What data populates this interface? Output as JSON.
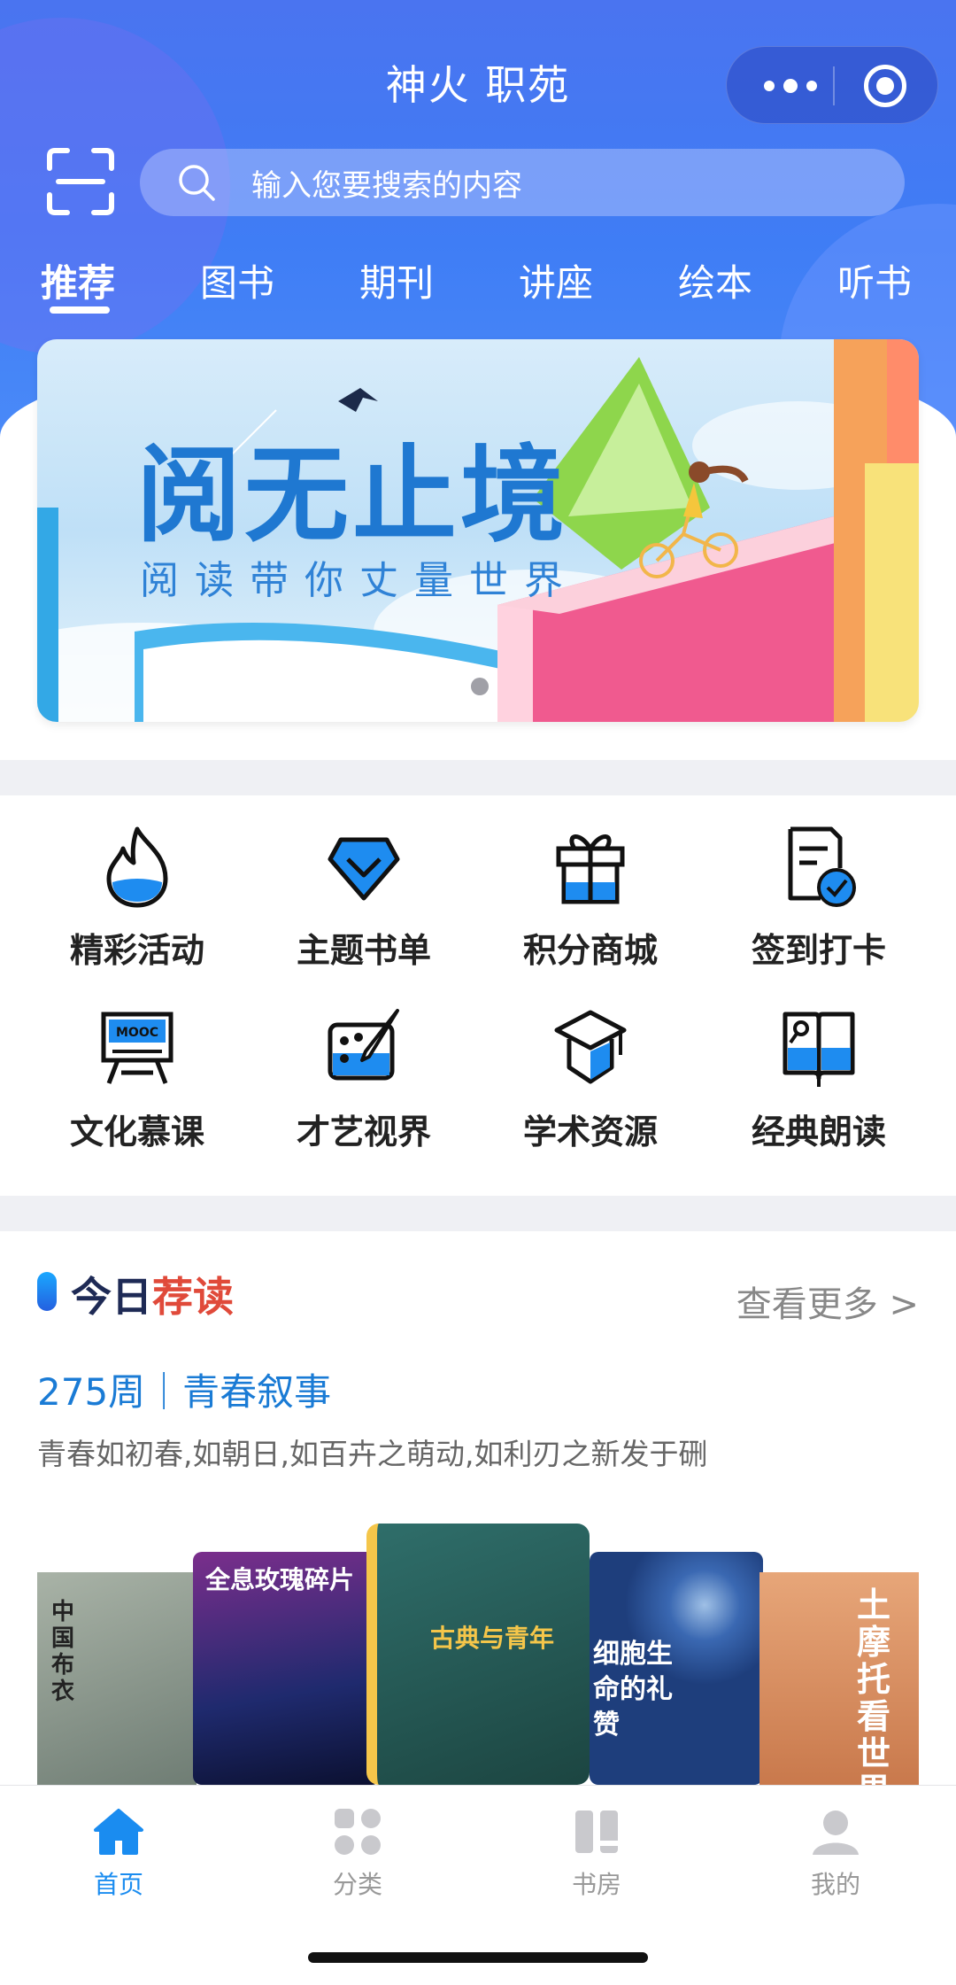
{
  "header": {
    "title": "神火 职苑",
    "search_placeholder": "输入您要搜索的内容",
    "tabs": [
      {
        "label": "推荐",
        "active": true
      },
      {
        "label": "图书",
        "active": false
      },
      {
        "label": "期刊",
        "active": false
      },
      {
        "label": "讲座",
        "active": false
      },
      {
        "label": "绘本",
        "active": false
      },
      {
        "label": "听书",
        "active": false
      }
    ]
  },
  "banner": {
    "title": "阅无止境",
    "subtitle": "阅读带你丈量世界"
  },
  "features": [
    {
      "label": "精彩活动",
      "icon": "flame-icon"
    },
    {
      "label": "主题书单",
      "icon": "diamond-icon"
    },
    {
      "label": "积分商城",
      "icon": "gift-icon"
    },
    {
      "label": "签到打卡",
      "icon": "checkin-icon"
    },
    {
      "label": "文化慕课",
      "icon": "mooc-icon"
    },
    {
      "label": "才艺视界",
      "icon": "palette-icon"
    },
    {
      "label": "学术资源",
      "icon": "graduation-cap-icon"
    },
    {
      "label": "经典朗读",
      "icon": "open-book-mic-icon"
    }
  ],
  "recommend": {
    "title_a": "今日",
    "title_b": "荐读",
    "more": "查看更多 >",
    "week": "275周｜青春叙事",
    "description": "青春如初春,如朝日,如百卉之萌动,如利刃之新发于硎",
    "books": [
      {
        "title": "中国布衣"
      },
      {
        "title": "全息玫瑰碎片"
      },
      {
        "title": "古典与青年"
      },
      {
        "title": "细胞生命的礼赞"
      },
      {
        "title": "土摩托看世界"
      }
    ]
  },
  "tabbar": [
    {
      "label": "首页",
      "icon": "home-icon",
      "active": true
    },
    {
      "label": "分类",
      "icon": "category-icon",
      "active": false
    },
    {
      "label": "书房",
      "icon": "bookshelf-icon",
      "active": false
    },
    {
      "label": "我的",
      "icon": "user-icon",
      "active": false
    }
  ],
  "colors": {
    "brand": "#3f7df5",
    "active_tab": "#1a8cf0",
    "accent_red": "#e04a3a"
  }
}
